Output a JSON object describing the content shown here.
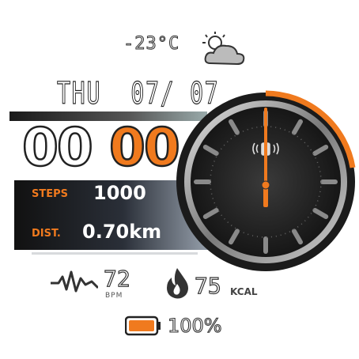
{
  "weather": {
    "temperature": "-23°C",
    "icon": "partly-cloudy-icon"
  },
  "date": {
    "weekday": "THU",
    "day_month": "07/ 07"
  },
  "time": {
    "hours": "00",
    "minutes": "00"
  },
  "steps": {
    "label": "STEPS",
    "value": "1000"
  },
  "distance": {
    "label": "DIST.",
    "value": "0.70km"
  },
  "heart_rate": {
    "value": "72",
    "unit": "BPM",
    "icon": "heartbeat-icon"
  },
  "calories": {
    "value": "75",
    "unit": "KCAL",
    "icon": "flame-icon"
  },
  "battery": {
    "value": "100%",
    "level": 1.0,
    "icon": "battery-icon"
  },
  "dial": {
    "center_icon": "vibration-icon"
  },
  "colors": {
    "accent": "#f07a1e",
    "dark": "#111111"
  }
}
